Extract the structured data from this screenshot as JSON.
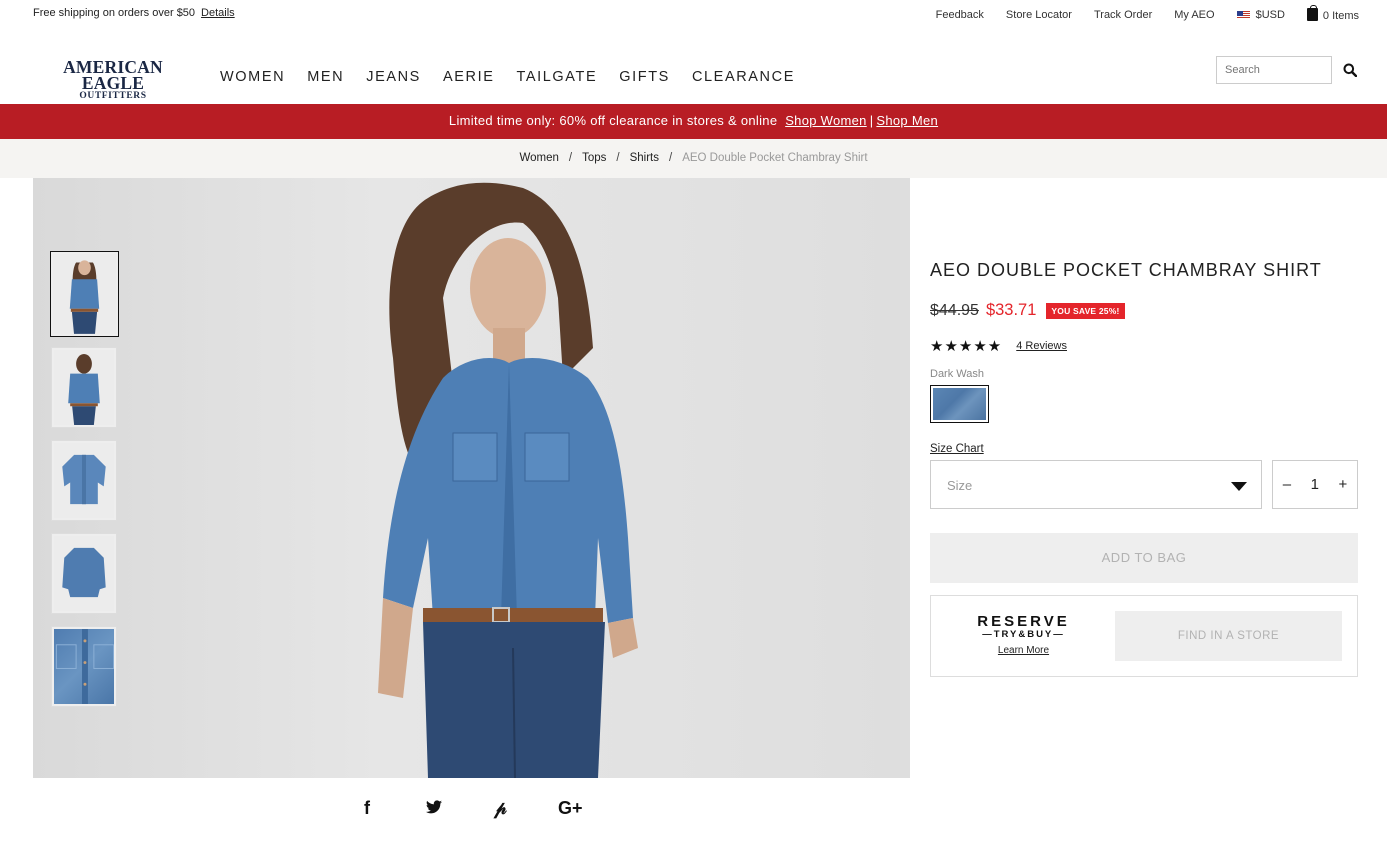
{
  "topbar": {
    "shipping_text": "Free shipping on orders over $50",
    "details_link": "Details",
    "links": {
      "feedback": "Feedback",
      "store_locator": "Store Locator",
      "track_order": "Track Order",
      "my_aeo": "My AEO",
      "currency": "$USD",
      "bag": "0 Items"
    }
  },
  "header": {
    "logo_line1": "AMERICAN EAGLE",
    "logo_line2": "OUTFITTERS",
    "nav": [
      "WOMEN",
      "MEN",
      "JEANS",
      "AERIE",
      "TAILGATE",
      "GIFTS",
      "CLEARANCE"
    ],
    "search_placeholder": "Search"
  },
  "promo": {
    "text": "Limited time only: 60% off clearance in stores & online",
    "link1": "Shop Women",
    "separator": "|",
    "link2": "Shop Men"
  },
  "breadcrumb": [
    "Women",
    "Tops",
    "Shirts",
    "AEO Double Pocket Chambray Shirt"
  ],
  "gallery": {
    "thumbnails": [
      "model-front",
      "model-back",
      "shirt-flat-front",
      "shirt-flat-back",
      "fabric-detail"
    ],
    "active_index": 0
  },
  "share": {
    "icons": [
      "facebook-icon",
      "twitter-icon",
      "pinterest-icon",
      "google-plus-icon"
    ],
    "labels": [
      "f",
      "🐦",
      "P",
      "G+"
    ]
  },
  "product": {
    "title": "AEO DOUBLE POCKET CHAMBRAY SHIRT",
    "original_price": "$44.95",
    "sale_price": "$33.71",
    "save_badge": "YOU SAVE 25%!",
    "rating_stars": "★★★★★",
    "rating_value": 5,
    "reviews_label": "4 Reviews",
    "color_label": "Dark Wash",
    "swatch_color": "#5580b0",
    "size_chart_label": "Size Chart",
    "size_placeholder": "Size",
    "quantity": "1",
    "qty_minus": "–",
    "qty_plus": "+",
    "add_to_bag": "ADD TO BAG",
    "reserve_line1": "RESERVE",
    "reserve_line2": "—TRY&BUY—",
    "learn_more": "Learn More",
    "find_in_store": "FIND IN A STORE"
  },
  "colors": {
    "promo_red": "#b81d24",
    "sale_red": "#e4252b",
    "brand_navy": "#1a2744"
  }
}
